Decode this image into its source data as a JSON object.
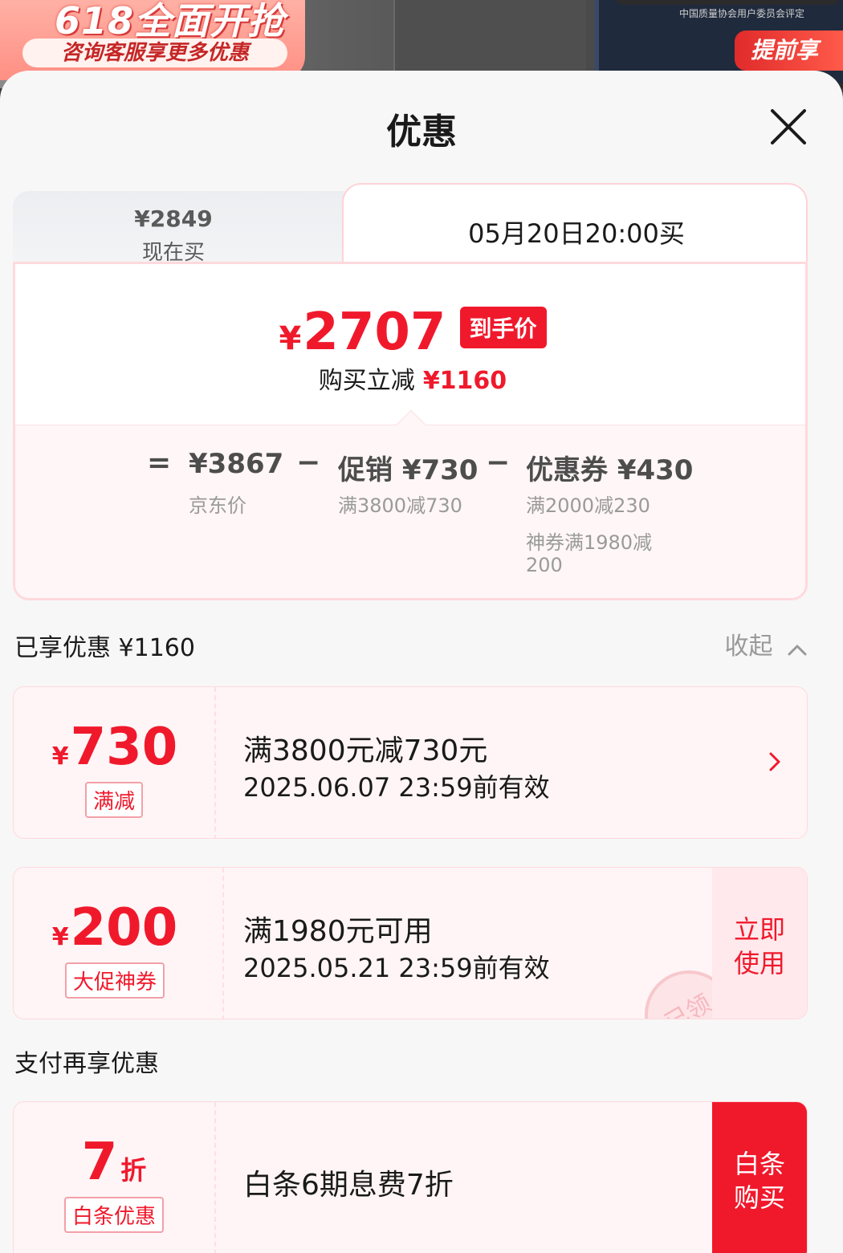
{
  "background": {
    "promo_big": "618全面开抢",
    "promo_pill": "咨询客服享更多优惠",
    "right_small": "中国质量协会用户委员会评定",
    "right_badge": "提前享"
  },
  "sheet": {
    "title": "优惠"
  },
  "tabs": {
    "now_price": "¥2849",
    "now_label": "现在买",
    "later_label": "05月20日20:00买"
  },
  "final": {
    "yen": "¥",
    "price": "2707",
    "tag": "到手价",
    "save_label": "购买立减",
    "save_amount": "¥1160"
  },
  "calc": {
    "eq": "=",
    "minus": "−",
    "jd_price": "¥3867",
    "jd_label": "京东价",
    "promo_value": "促销 ¥730",
    "promo_detail": "满3800减730",
    "coupon_value": "优惠券 ¥430",
    "coupon_detail_1": "满2000减230",
    "coupon_detail_2a": "神券满1980减",
    "coupon_detail_2b": "200"
  },
  "enjoyed": {
    "label": "已享优惠 ¥1160",
    "collapse": "收起"
  },
  "coupons": [
    {
      "yen": "¥",
      "amount": "730",
      "tag": "满减",
      "title": "满3800元减730元",
      "date": "2025.06.07 23:59前有效"
    },
    {
      "yen": "¥",
      "amount": "200",
      "tag": "大促神券",
      "title": "满1980元可用",
      "date": "2025.05.21 23:59前有效",
      "action_1": "立即",
      "action_2": "使用",
      "stamp": "已领"
    }
  ],
  "pay": {
    "section": "支付再享优惠",
    "amount": "7",
    "unit": "折",
    "tag": "白条优惠",
    "title": "白条6期息费7折",
    "action_1": "白条",
    "action_2": "购买"
  },
  "colors": {
    "accent": "#f0192c",
    "card_border": "#ffd9dd",
    "coupon_bg": "#fff5f6"
  }
}
